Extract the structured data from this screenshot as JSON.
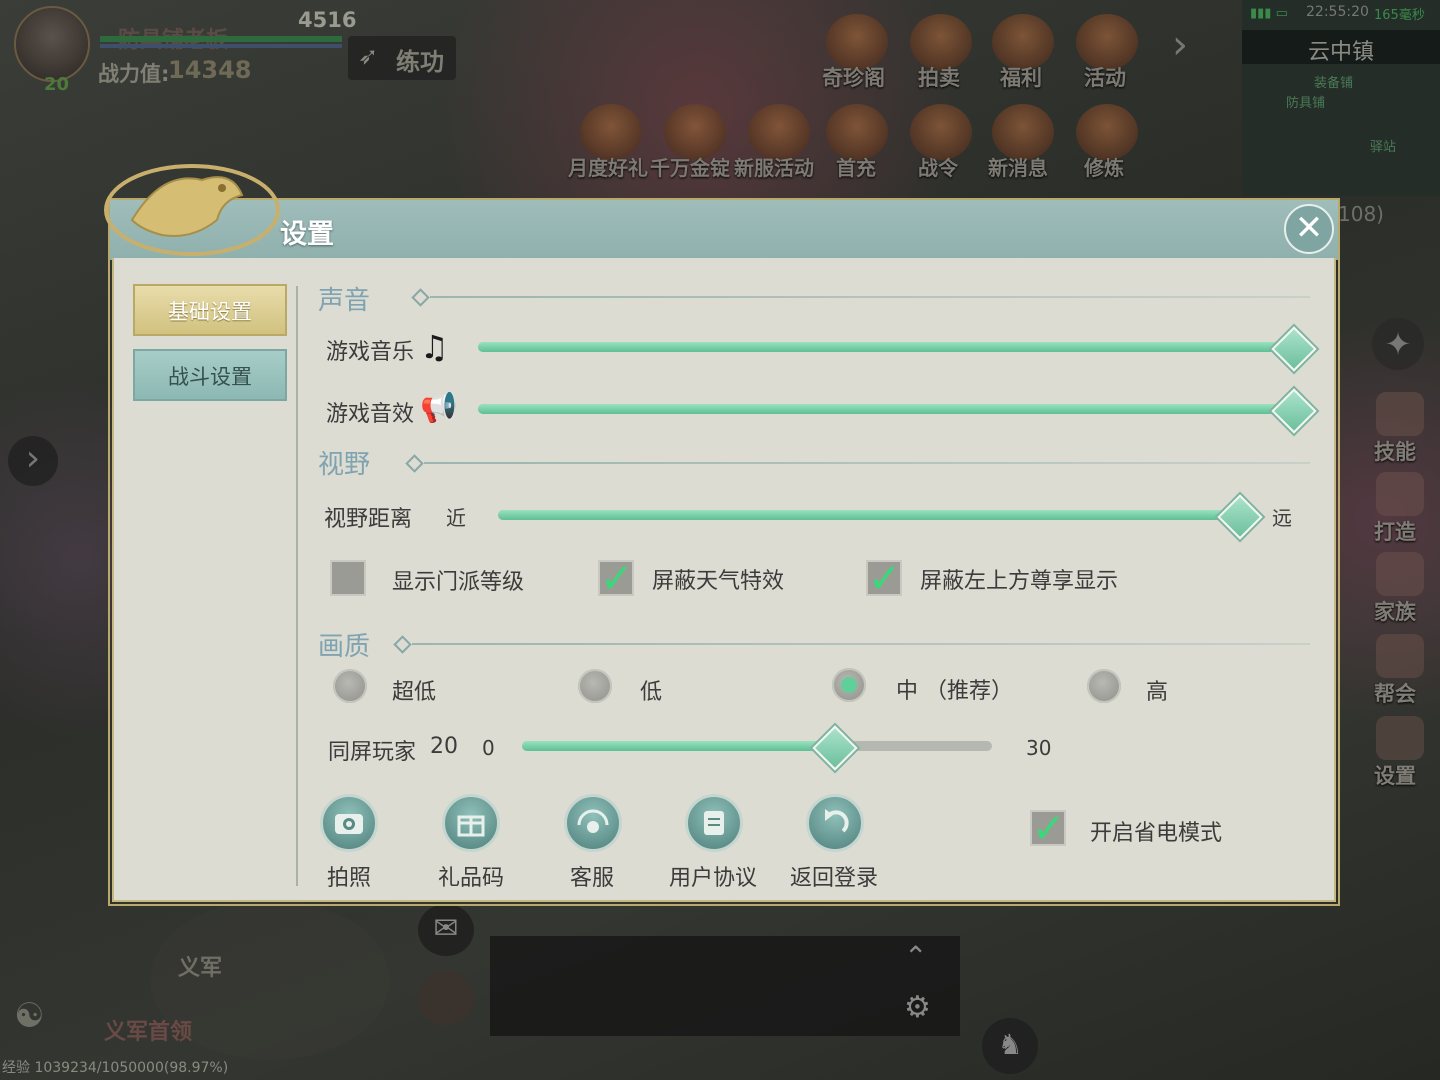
{
  "hud": {
    "player_name": "防具铺老板",
    "level": "20",
    "hp_value": "4516",
    "power_label": "战力值:",
    "power_value": "14348",
    "practice_label": "练功",
    "top_menu": [
      "奇珍阁",
      "拍卖",
      "福利",
      "活动"
    ],
    "event_menu": [
      "月度好礼",
      "千万金锭",
      "新服活动",
      "首充",
      "战令",
      "新消息",
      "修炼"
    ],
    "status_time": "22:55:20",
    "status_ping": "165毫秒",
    "map_name": "云中镇",
    "map_labels": [
      "防具铺",
      "装备铺",
      "驿站"
    ],
    "map_coords": "108)",
    "side_menu": [
      "技能",
      "打造",
      "家族",
      "帮会",
      "设置"
    ],
    "bottom_labels": [
      "义军",
      "义军首领"
    ],
    "exp_text": "经验 1039234/1050000(98.97%)"
  },
  "dialog": {
    "title": "设置",
    "close_label": "✕",
    "tabs": [
      {
        "label": "基础设置",
        "active": true
      },
      {
        "label": "战斗设置",
        "active": false
      }
    ],
    "sections": {
      "sound": "声音",
      "view": "视野",
      "quality": "画质"
    },
    "sound": {
      "music_label": "游戏音乐",
      "music_value": 1.0,
      "sfx_label": "游戏音效",
      "sfx_value": 1.0
    },
    "view": {
      "distance_label": "视野距离",
      "near_label": "近",
      "far_label": "远",
      "distance_value": 1.0,
      "checkboxes": [
        {
          "label": "显示门派等级",
          "checked": false
        },
        {
          "label": "屏蔽天气特效",
          "checked": true
        },
        {
          "label": "屏蔽左上方尊享显示",
          "checked": true
        }
      ]
    },
    "quality": {
      "options": [
        {
          "label": "超低",
          "selected": false
        },
        {
          "label": "低",
          "selected": false
        },
        {
          "label": "中 （推荐）",
          "selected": true
        },
        {
          "label": "高",
          "selected": false
        }
      ],
      "players_label": "同屏玩家",
      "players_value": "20",
      "players_min": "0",
      "players_max": "30",
      "players_numeric": 20
    },
    "buttons": [
      "拍照",
      "礼品码",
      "客服",
      "用户协议",
      "返回登录"
    ],
    "power_save": {
      "label": "开启省电模式",
      "checked": true
    }
  },
  "colors": {
    "accent_green": "#5fbf94",
    "header_teal": "#8fb0ad",
    "panel_bg": "#dcdcd2",
    "gold_border": "#b9aa6c"
  }
}
